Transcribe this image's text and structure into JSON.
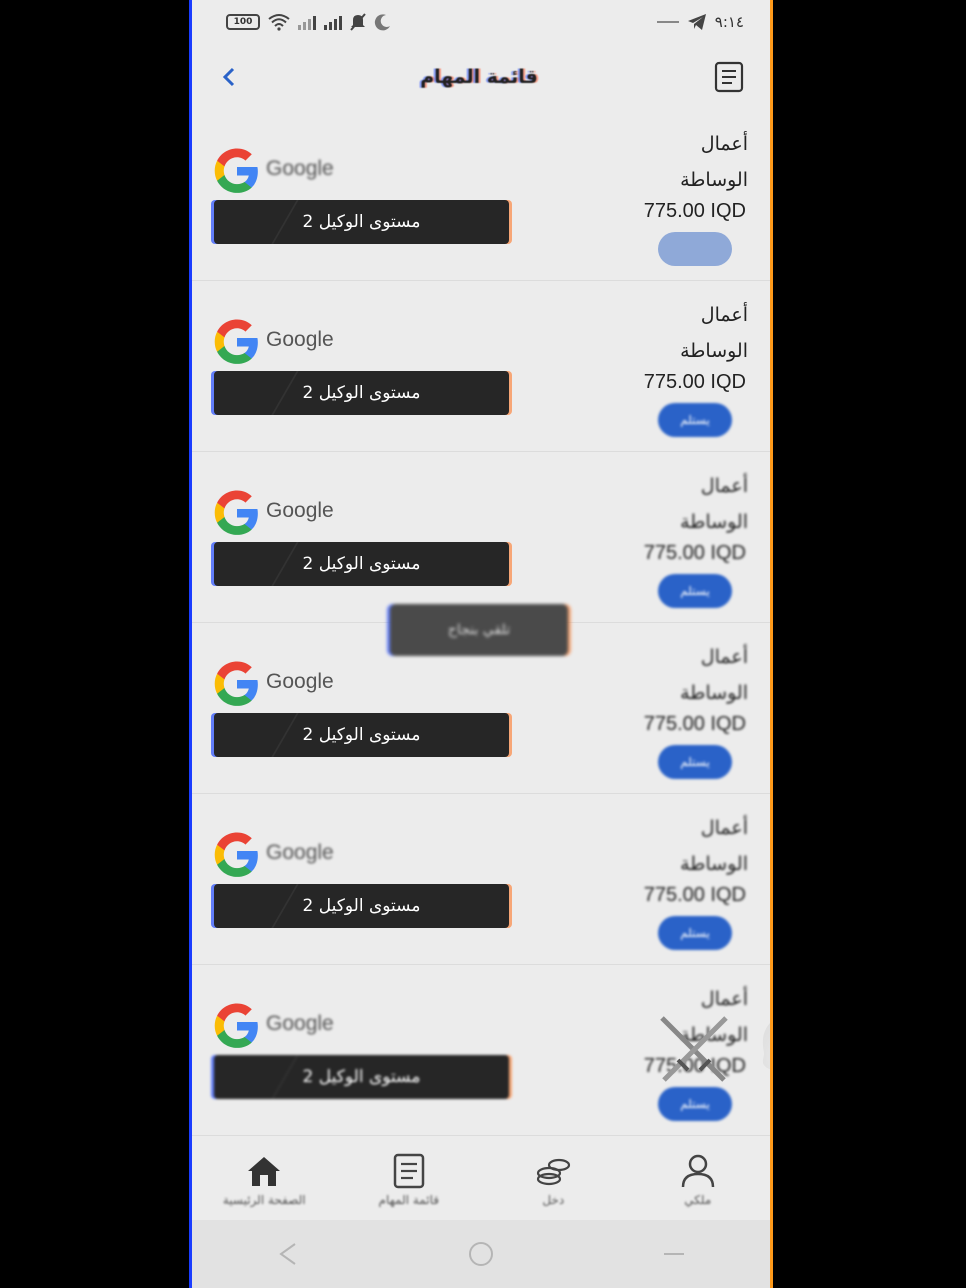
{
  "status_bar": {
    "battery": "100",
    "time": "٩:١٤"
  },
  "header": {
    "title": "قائمة المهام"
  },
  "tasks": [
    {
      "brand": "Google",
      "agent_level": "مستوى الوكيل 2",
      "name": "أعمال الوساطة",
      "price": "775.00 IQD",
      "button": "",
      "pressed": true
    },
    {
      "brand": "Google",
      "agent_level": "مستوى الوكيل 2",
      "name": "أعمال الوساطة",
      "price": "775.00 IQD",
      "button": "يستلم",
      "pressed": false
    },
    {
      "brand": "Google",
      "agent_level": "مستوى الوكيل 2",
      "name": "أعمال الوساطة",
      "price": "775.00 IQD",
      "button": "يستلم",
      "pressed": false
    },
    {
      "brand": "Google",
      "agent_level": "مستوى الوكيل 2",
      "name": "أعمال الوساطة",
      "price": "775.00 IQD",
      "button": "يستلم",
      "pressed": false
    },
    {
      "brand": "Google",
      "agent_level": "مستوى الوكيل 2",
      "name": "أعمال الوساطة",
      "price": "775.00 IQD",
      "button": "يستلم",
      "pressed": false
    },
    {
      "brand": "Google",
      "agent_level": "مستوى الوكيل 2",
      "name": "أعمال الوساطة",
      "price": "775.00 IQD",
      "button": "يستلم",
      "pressed": false
    }
  ],
  "toast": "تلقي بنجاح",
  "bottom_nav": [
    {
      "label": "الصفحة الرئيسية",
      "icon": "home-icon"
    },
    {
      "label": "قائمة المهام",
      "icon": "task-list-icon"
    },
    {
      "label": "دخل",
      "icon": "income-coins-icon"
    },
    {
      "label": "ملكي",
      "icon": "profile-icon"
    }
  ],
  "colors": {
    "accent": "#2a62c8",
    "pill_bg": "#262626",
    "screen_bg": "#ececec"
  }
}
